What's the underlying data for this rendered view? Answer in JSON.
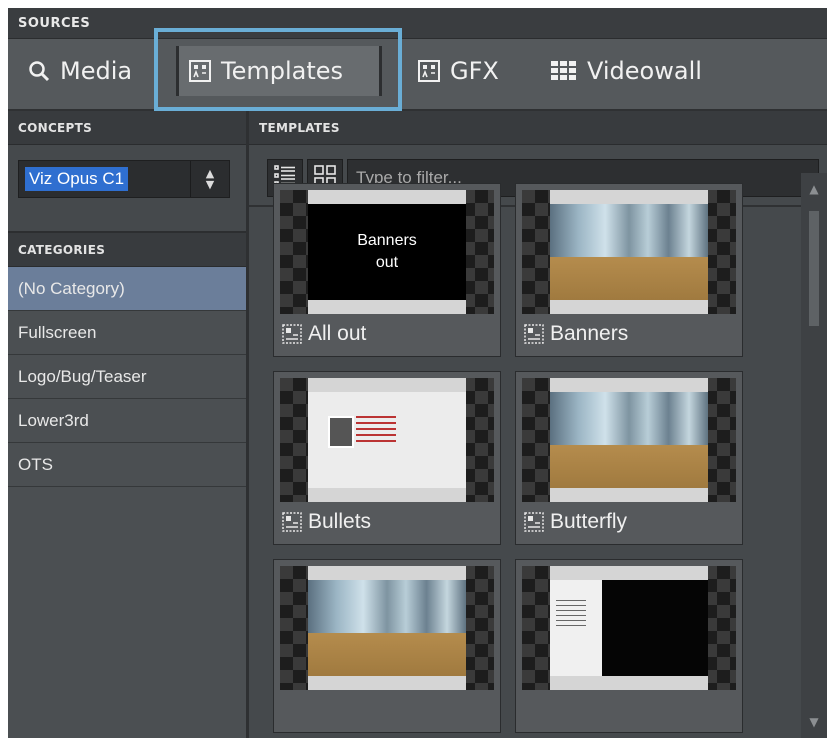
{
  "sources": {
    "title": "SOURCES",
    "tabs": [
      {
        "label": "Media",
        "icon": "search-icon"
      },
      {
        "label": "Templates",
        "icon": "template-icon",
        "selected": true
      },
      {
        "label": "GFX",
        "icon": "template-icon"
      },
      {
        "label": "Videowall",
        "icon": "videowall-grid-icon"
      }
    ],
    "highlight_color": "#6aaed6"
  },
  "concepts": {
    "header": "CONCEPTS",
    "selected_value": "Viz Opus C1"
  },
  "categories": {
    "header": "CATEGORIES",
    "items": [
      {
        "label": "(No Category)",
        "selected": true
      },
      {
        "label": "Fullscreen"
      },
      {
        "label": "Logo/Bug/Teaser"
      },
      {
        "label": "Lower3rd"
      },
      {
        "label": "OTS"
      }
    ],
    "selected_color": "#6b7e9a"
  },
  "templates": {
    "header": "TEMPLATES",
    "filter_placeholder": "Type to filter...",
    "items": [
      {
        "label": "All out",
        "thumb_text": "Banners\nout",
        "thumb_kind": "black-text"
      },
      {
        "label": "Banners",
        "thumb_kind": "office"
      },
      {
        "label": "Bullets",
        "thumb_kind": "bullets"
      },
      {
        "label": "Butterfly",
        "thumb_kind": "office"
      },
      {
        "label": "",
        "thumb_kind": "office"
      },
      {
        "label": "",
        "thumb_kind": "dark-side"
      }
    ]
  }
}
